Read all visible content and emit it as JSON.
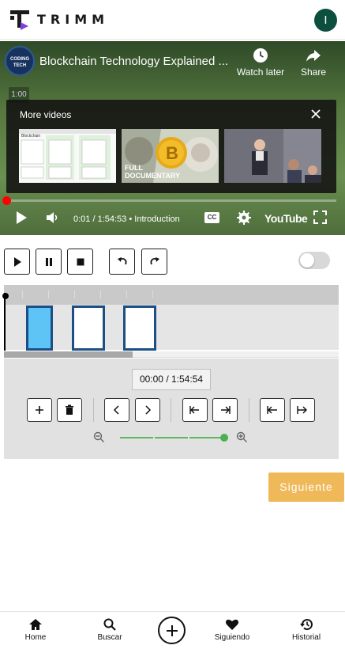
{
  "header": {
    "brand": "TRIMM",
    "avatar_initial": "I"
  },
  "video": {
    "channel_logo_text": "CODING TECH",
    "title": "Blockchain Technology Explained ...",
    "watch_later_label": "Watch later",
    "share_label": "Share",
    "time_chip": "1:00",
    "more_videos_title": "More videos",
    "thumb_2_caption": "FULL DOCUMENTARY",
    "thumb_1_heading": "Blockchain",
    "progress_fraction": 0.0001,
    "current_time": "0:01",
    "duration": "1:54:53",
    "chapter": "Introduction",
    "cc_label": "CC",
    "youtube_label": "YouTube"
  },
  "transport": {
    "play_icon": "play-icon",
    "pause_icon": "pause-icon",
    "stop_icon": "stop-icon",
    "undo_icon": "undo-icon",
    "redo_icon": "redo-icon",
    "toggle_on": false
  },
  "editor": {
    "time_display": "00:00 / 1:54:54",
    "zoom_level": 1.0
  },
  "actions": {
    "next_label": "Siguiente"
  },
  "nav": {
    "items": [
      {
        "label": "Home",
        "icon": "home-icon"
      },
      {
        "label": "Buscar",
        "icon": "search-icon"
      },
      {
        "label": "Siguiendo",
        "icon": "heart-icon"
      },
      {
        "label": "Historial",
        "icon": "history-icon"
      }
    ],
    "add_icon": "plus-icon"
  },
  "colors": {
    "accent": "#efb95a",
    "clip_border": "#1b4f86",
    "clip_selected": "#5ec3f5",
    "zoom": "#4caf50",
    "avatar": "#0d4f3f"
  }
}
